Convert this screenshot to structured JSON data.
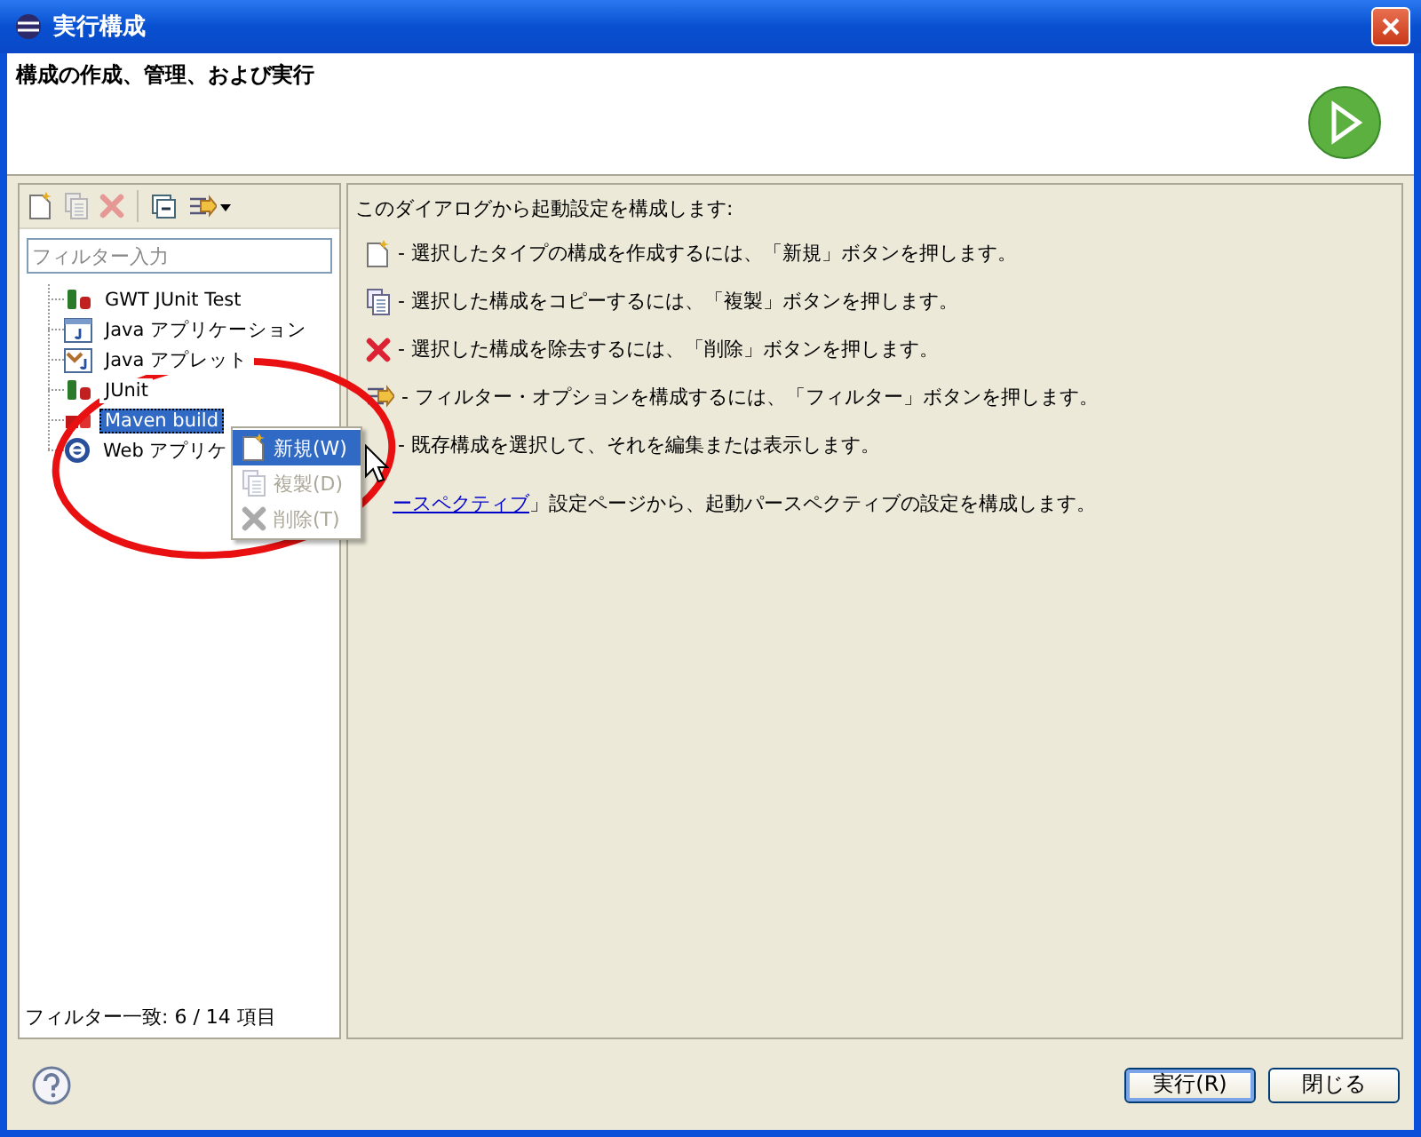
{
  "window": {
    "title": "実行構成"
  },
  "header": {
    "title": "構成の作成、管理、および実行"
  },
  "toolbar": [
    {
      "kind": "new",
      "disabled": false
    },
    {
      "kind": "duplicate",
      "disabled": true
    },
    {
      "kind": "delete",
      "disabled": true
    },
    {
      "kind": "collapse",
      "disabled": false
    },
    {
      "kind": "filter",
      "disabled": false
    }
  ],
  "filter": {
    "placeholder": "フィルター入力"
  },
  "tree": [
    {
      "label": "GWT JUnit Test",
      "kind": "junit",
      "selected": false
    },
    {
      "label": "Java アプリケーション",
      "kind": "java-app",
      "selected": false
    },
    {
      "label": "Java アプレット",
      "kind": "applet",
      "selected": false
    },
    {
      "label": "JUnit",
      "kind": "junit",
      "selected": false
    },
    {
      "label": "Maven build",
      "kind": "maven",
      "selected": true
    },
    {
      "label": "Web アプリケ",
      "kind": "web",
      "selected": false
    }
  ],
  "filter_status": "フィルター一致: 6 / 14 項目",
  "info": {
    "intro": "このダイアログから起動設定を構成します:",
    "lines": [
      {
        "kind": "new",
        "text": "- 選択したタイプの構成を作成するには、「新規」ボタンを押します。"
      },
      {
        "kind": "duplicate",
        "text": "- 選択した構成をコピーするには、「複製」ボタンを押します。"
      },
      {
        "kind": "delete",
        "text": "- 選択した構成を除去するには、「削除」ボタンを押します。"
      },
      {
        "kind": "filter",
        "text": "- フィルター・オプションを構成するには、「フィルター」ボタンを押します。"
      },
      {
        "kind": "blank",
        "text": "- 既存構成を選択して、それを編集または表示します。"
      }
    ],
    "footer_link": "ースペクティブ",
    "footer_text": "」設定ページから、起動パースペクティブの設定を構成します。"
  },
  "context_menu": [
    {
      "label": "新規(W)",
      "kind": "new",
      "selected": true,
      "disabled": false
    },
    {
      "label": "複製(D)",
      "kind": "duplicate",
      "selected": false,
      "disabled": true
    },
    {
      "label": "削除(T)",
      "kind": "delete",
      "selected": false,
      "disabled": true
    }
  ],
  "buttons": [
    {
      "label": "実行(R)",
      "default": true
    },
    {
      "label": "閉じる",
      "default": false
    }
  ]
}
